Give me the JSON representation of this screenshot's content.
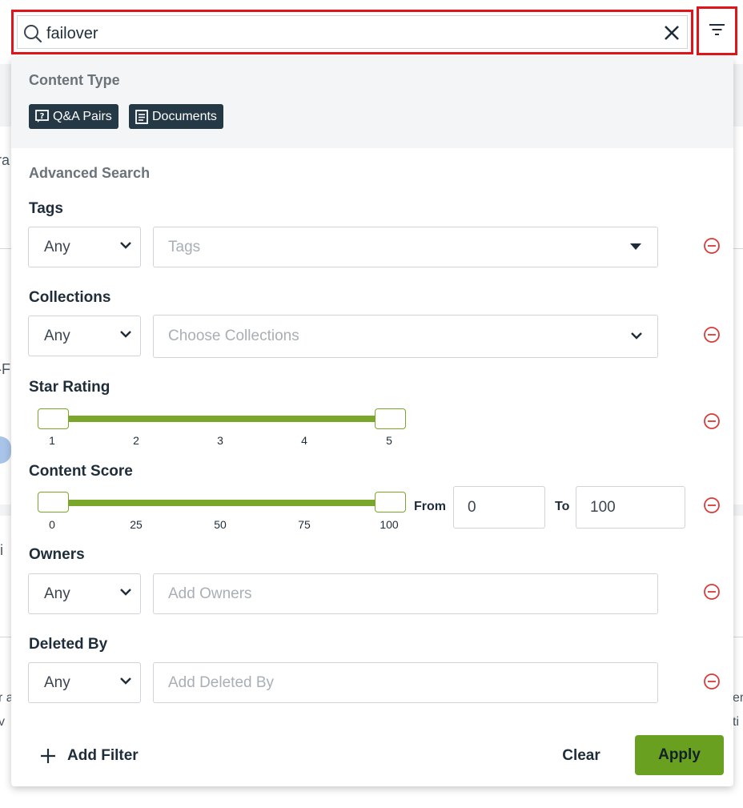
{
  "search": {
    "value": "failover"
  },
  "content_type": {
    "title": "Content Type",
    "chips": [
      {
        "label": "Q&A Pairs",
        "icon": "qa-icon"
      },
      {
        "label": "Documents",
        "icon": "document-icon"
      }
    ]
  },
  "advanced": {
    "title": "Advanced Search"
  },
  "tags": {
    "label": "Tags",
    "operator": "Any",
    "placeholder": "Tags"
  },
  "collections": {
    "label": "Collections",
    "operator": "Any",
    "placeholder": "Choose Collections"
  },
  "star_rating": {
    "label": "Star Rating",
    "ticks": [
      "1",
      "2",
      "3",
      "4",
      "5"
    ],
    "min": 1,
    "max": 5,
    "selected_low": 1,
    "selected_high": 5
  },
  "content_score": {
    "label": "Content Score",
    "ticks": [
      "0",
      "25",
      "50",
      "75",
      "100"
    ],
    "min": 0,
    "max": 100,
    "selected_low": 0,
    "selected_high": 100,
    "from_label": "From",
    "from_value": "0",
    "to_label": "To",
    "to_value": "100"
  },
  "owners": {
    "label": "Owners",
    "operator": "Any",
    "placeholder": "Add Owners"
  },
  "deleted_by": {
    "label": "Deleted By",
    "operator": "Any",
    "placeholder": "Add Deleted By"
  },
  "footer": {
    "add_filter": "Add Filter",
    "clear": "Clear",
    "apply": "Apply"
  },
  "colors": {
    "accent": "#7aa72a",
    "apply_bg": "#6aa01f",
    "chip_bg": "#253846",
    "danger": "#d93a3a",
    "highlight": "#e0151b"
  }
}
